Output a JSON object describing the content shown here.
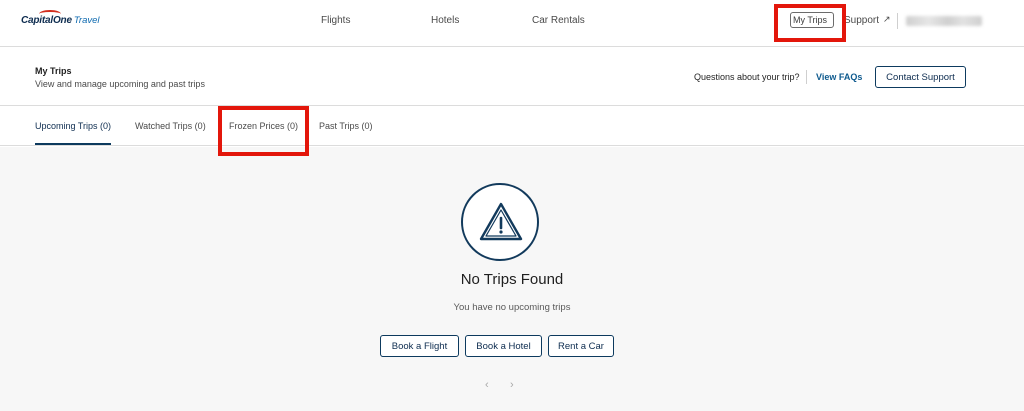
{
  "brand": {
    "capital": "Capital",
    "one": "One",
    "travel": "Travel"
  },
  "nav": {
    "flights": "Flights",
    "hotels": "Hotels",
    "car_rentals": "Car Rentals",
    "my_trips": "My Trips",
    "support": "Support",
    "support_icon": "external-link-icon"
  },
  "header": {
    "title": "My Trips",
    "subtitle": "View and manage upcoming and past trips",
    "question": "Questions about your trip?",
    "faqs": "View FAQs",
    "contact": "Contact Support"
  },
  "tabs": [
    {
      "label": "Upcoming Trips (0)",
      "active": true
    },
    {
      "label": "Watched Trips (0)",
      "active": false
    },
    {
      "label": "Frozen Prices (0)",
      "active": false
    },
    {
      "label": "Past Trips (0)",
      "active": false
    }
  ],
  "empty": {
    "icon": "warning-icon",
    "title": "No Trips Found",
    "subtitle": "You have no upcoming trips",
    "buttons": [
      "Book a Flight",
      "Book a Hotel",
      "Rent a Car"
    ],
    "prev": "‹",
    "next": "›"
  },
  "colors": {
    "brand_navy": "#0d2c4f",
    "link_blue": "#0e5a8e",
    "annotation_red": "#e3160b"
  }
}
